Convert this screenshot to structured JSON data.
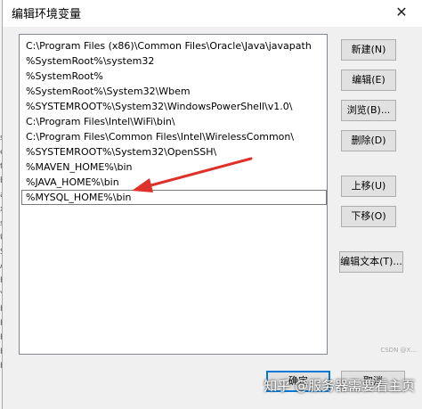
{
  "window": {
    "title": "编辑环境变量",
    "close_glyph": "✕"
  },
  "background_strip": [
    "s",
    "e",
    "t",
    "b",
    "a",
    "x",
    "s",
    "U",
    "S",
    "A",
    "R",
    "Y",
    "R",
    "R",
    "R",
    "P",
    "P"
  ],
  "path_list": [
    "C:\\Program Files (x86)\\Common Files\\Oracle\\Java\\javapath",
    "%SystemRoot%\\system32",
    "%SystemRoot%",
    "%SystemRoot%\\System32\\Wbem",
    "%SYSTEMROOT%\\System32\\WindowsPowerShell\\v1.0\\",
    "C:\\Program Files\\Intel\\WiFi\\bin\\",
    "C:\\Program Files\\Common Files\\Intel\\WirelessCommon\\",
    "%SYSTEMROOT%\\System32\\OpenSSH\\",
    "%MAVEN_HOME%\\bin",
    "%JAVA_HOME%\\bin",
    "%MYSQL_HOME%\\bin"
  ],
  "selected_index": 10,
  "buttons": {
    "new": "新建(N)",
    "edit": "编辑(E)",
    "browse": "浏览(B)...",
    "delete": "删除(D)",
    "move_up": "上移(U)",
    "move_down": "下移(O)",
    "edit_text": "编辑文本(T)...",
    "ok": "确定",
    "cancel": "取消"
  },
  "watermark": {
    "main": "知乎 @服务器需要看主页",
    "small": "CSDN @X..."
  },
  "colors": {
    "annotation_arrow": "#e0302a",
    "default_button_border": "#0078d7"
  }
}
